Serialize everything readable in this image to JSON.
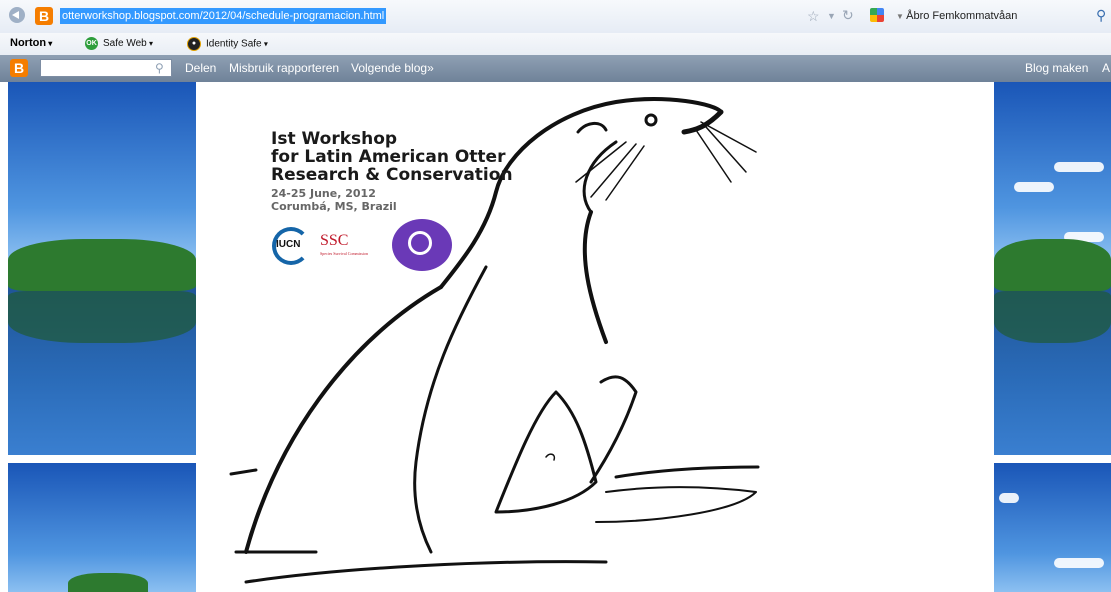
{
  "browser": {
    "url": "otterworkshop.blogspot.com/2012/04/schedule-programacion.html",
    "search_engine": "Åbro Femkommatvåan"
  },
  "norton_toolbar": {
    "brand": "Norton",
    "safe_web_label": "Safe Web",
    "safe_web_badge": "OK",
    "identity_safe_label": "Identity Safe"
  },
  "blogger_bar": {
    "search_placeholder": "",
    "links": [
      "Delen",
      "Misbruik rapporteren",
      "Volgende blog»"
    ],
    "right_links": [
      "Blog maken",
      "A"
    ]
  },
  "poster": {
    "title_lines": [
      "Ist Workshop",
      "for Latin American Otter",
      "Research & Conservation"
    ],
    "dates": "24-25 June, 2012",
    "location": "Corumbá, MS, Brazil",
    "logos": {
      "iucn": "IUCN",
      "ssc": "SSC",
      "ssc_tagline": "Species Survival Commission"
    }
  },
  "colors": {
    "url_highlight": "#3399ff",
    "blogger_orange": "#f57d00",
    "blogger_bar": "#7b8ca2",
    "iucn_blue": "#1565a8",
    "ssc_red": "#c0192a",
    "otter_logo_purple": "#6a39b7"
  },
  "icons": {
    "back": "back-arrow-icon",
    "bookmark_star": "star-icon",
    "dropdown": "chevron-down-icon",
    "reload": "reload-icon",
    "search": "search-icon"
  }
}
